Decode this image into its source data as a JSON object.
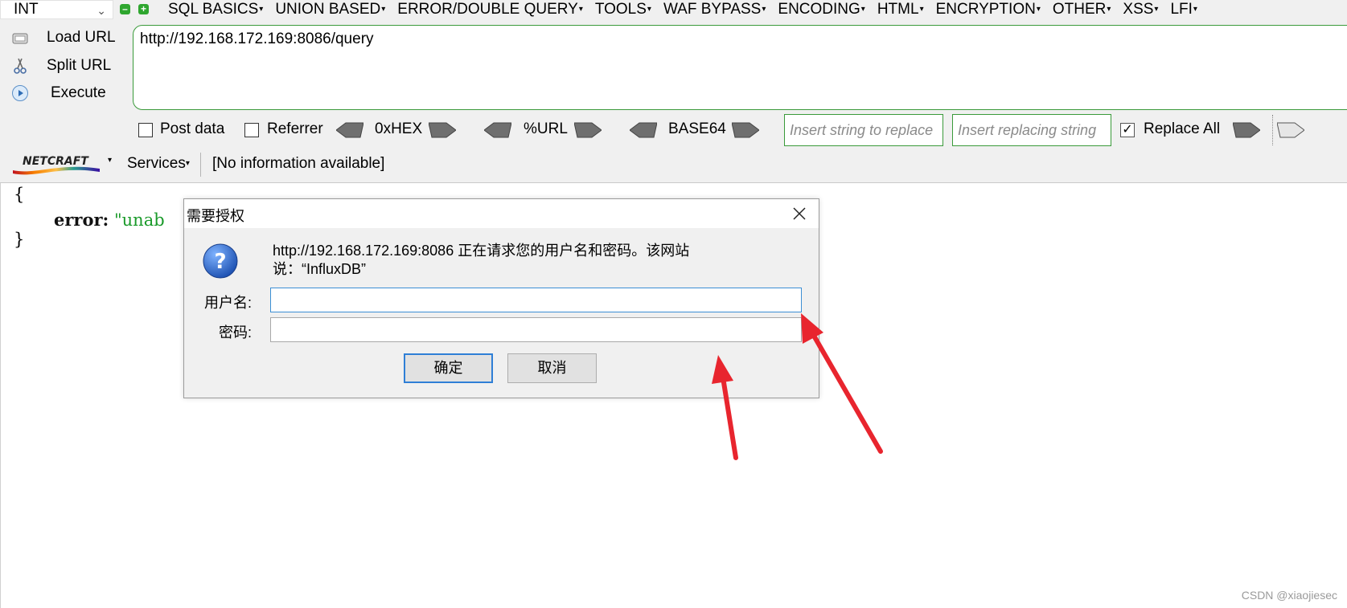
{
  "hackbar": {
    "select_value": "INT",
    "menu": [
      {
        "label": "SQL BASICS"
      },
      {
        "label": "UNION BASED"
      },
      {
        "label": "ERROR/DOUBLE QUERY"
      },
      {
        "label": "TOOLS"
      },
      {
        "label": "WAF BYPASS"
      },
      {
        "label": "ENCODING"
      },
      {
        "label": "HTML"
      },
      {
        "label": "ENCRYPTION"
      },
      {
        "label": "OTHER"
      },
      {
        "label": "XSS"
      },
      {
        "label": "LFI"
      }
    ],
    "actions": {
      "load_url": "Load URL",
      "split_url": "Split URL",
      "execute": "Execute"
    },
    "url": "http://192.168.172.169:8086/query",
    "options": {
      "post_data": "Post data",
      "referrer": "Referrer",
      "hex": "0xHEX",
      "url_enc": "%URL",
      "base64": "BASE64",
      "replace_all": "Replace All",
      "replace_all_checked": true,
      "insert_string_placeholder": "Insert string to replace",
      "insert_replacing_placeholder": "Insert replacing string"
    }
  },
  "netcraft": {
    "logo_text": "NETCRAFT",
    "services": "Services",
    "info": "[No information available]"
  },
  "content": {
    "open_brace": "{",
    "key": "error:",
    "value_fragment": "\"unab",
    "close_brace": "}"
  },
  "dialog": {
    "title": "需要授权",
    "message_line1": "http://192.168.172.169:8086 正在请求您的用户名和密码。该网站",
    "message_line2": "说：“InfluxDB”",
    "username_label": "用户名:",
    "password_label": "密码:",
    "username_value": "",
    "password_value": "",
    "ok": "确定",
    "cancel": "取消"
  },
  "annotation_color": "#e8252e",
  "watermark": "CSDN @xiaojiesec"
}
